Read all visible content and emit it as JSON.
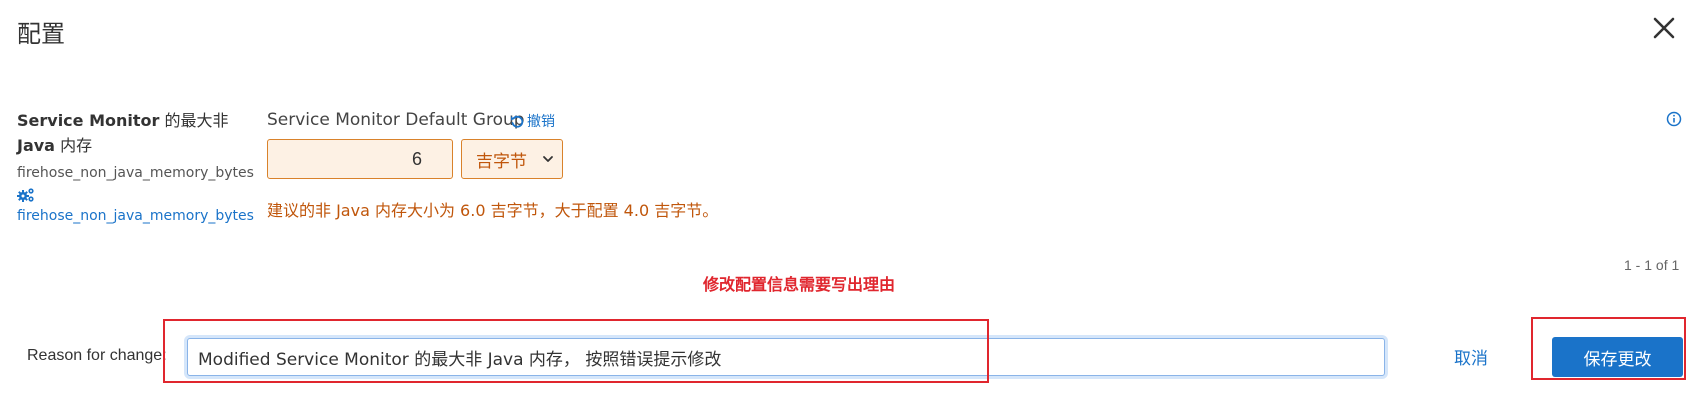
{
  "dialog": {
    "title": "配置"
  },
  "property": {
    "name_bold_1": "Service Monitor",
    "name_rest_1": " 的最大非",
    "name_bold_2": "Java",
    "name_rest_2": " 内存",
    "key": "firehose_non_java_memory_bytes",
    "link": "firehose_non_java_memory_bytes",
    "group_label": "Service Monitor Default Group",
    "undo_label": "撤销",
    "value": "6",
    "unit": "吉字节",
    "warning": "建议的非 Java 内存大小为 6.0 吉字节，大于配置 4.0 吉字节。"
  },
  "pager": {
    "text": "1 - 1 of 1"
  },
  "annotation": {
    "text": "修改配置信息需要写出理由"
  },
  "footer": {
    "reason_label": "Reason for change:",
    "reason_value": "Modified Service Monitor 的最大非 Java 内存， 按照错误提示修改",
    "cancel_label": "取消",
    "save_label": "保存更改"
  },
  "colors": {
    "accent": "#1a73c9",
    "warning": "#c0560b",
    "annotation": "#e0262e",
    "input_bg": "#fdf1e4"
  }
}
